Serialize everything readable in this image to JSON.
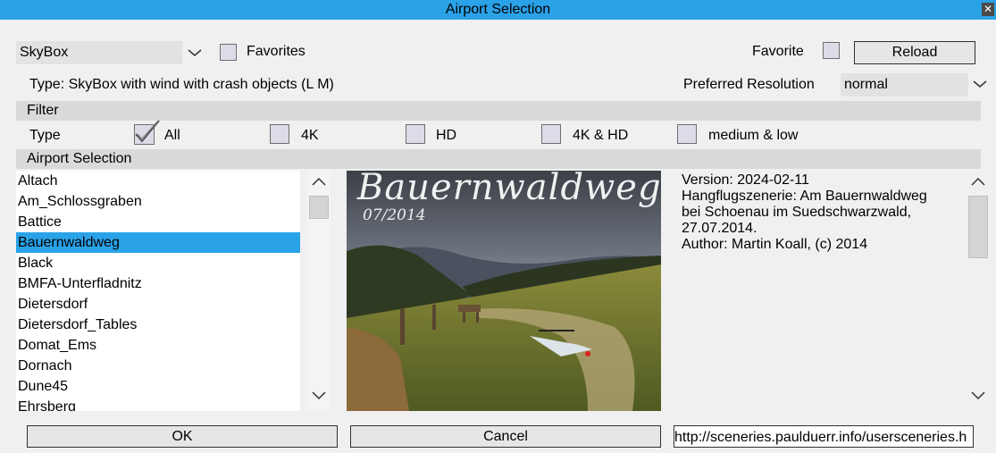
{
  "window": {
    "title": "Airport Selection",
    "close_icon": "close-icon"
  },
  "top": {
    "scenery_type": "SkyBox",
    "favorites_filter_label": "Favorites",
    "favorite_label": "Favorite",
    "reload_label": "Reload"
  },
  "info": {
    "type_text": "Type: SkyBox with wind with crash objects (L M)",
    "pref_res_label": "Preferred Resolution",
    "pref_res_value": "normal"
  },
  "filter": {
    "section_label": "Filter",
    "type_label": "Type",
    "options": [
      {
        "label": "All",
        "checked": true
      },
      {
        "label": "4K",
        "checked": false
      },
      {
        "label": "HD",
        "checked": false
      },
      {
        "label": "4K & HD",
        "checked": false
      },
      {
        "label": "medium & low",
        "checked": false
      }
    ]
  },
  "airports": {
    "section_label": "Airport Selection",
    "items": [
      "Altach",
      "Am_Schlossgraben",
      "Battice",
      "Bauernwaldweg",
      "Black",
      "BMFA-Unterfladnitz",
      "Dietersdorf",
      "Dietersdorf_Tables",
      "Domat_Ems",
      "Dornach",
      "Dune45",
      "Ehrsberg"
    ],
    "selected_index": 3,
    "selected_color": "#2aa2e8"
  },
  "preview": {
    "title": "Bauernwaldweg",
    "date": "07/2014"
  },
  "description": {
    "lines": [
      "Version: 2024-02-11",
      "Hangflugszenerie: Am Bauernwaldweg",
      "bei Schoenau im Suedschwarzwald,",
      "27.07.2014.",
      "Author: Martin Koall, (c) 2014"
    ]
  },
  "bottom": {
    "ok_label": "OK",
    "cancel_label": "Cancel",
    "url": "http://sceneries.paulduerr.info/usersceneries.h"
  },
  "colors": {
    "accent": "#2aa2e8",
    "background": "#f0f0f0"
  }
}
